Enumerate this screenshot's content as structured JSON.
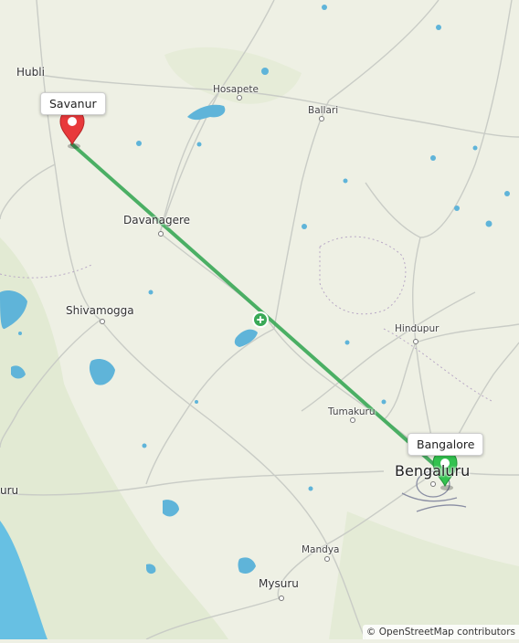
{
  "map": {
    "cities": {
      "hubli": "Hubli",
      "hosapete": "Hosapete",
      "ballari": "Ballari",
      "davanagere": "Davanagere",
      "shivamogga": "Shivamogga",
      "hindupur": "Hindupur",
      "tumakuru": "Tumakuru",
      "bengaluru": "Bengaluru",
      "left_edge": "uru",
      "mandya": "Mandya",
      "mysuru": "Mysuru"
    },
    "route": {
      "start_label": "Savanur",
      "end_label": "Bangalore",
      "start_marker_color": "#e8393b",
      "end_marker_color": "#33c24f",
      "line_color": "#3aa957",
      "midpoint_icon": "route-direction-icon"
    },
    "colors": {
      "land": "#eef0e4",
      "water": "#5fb4d9",
      "sea": "#67c0e3",
      "roads": "#c7cac5"
    }
  },
  "attribution": "© OpenStreetMap contributors"
}
